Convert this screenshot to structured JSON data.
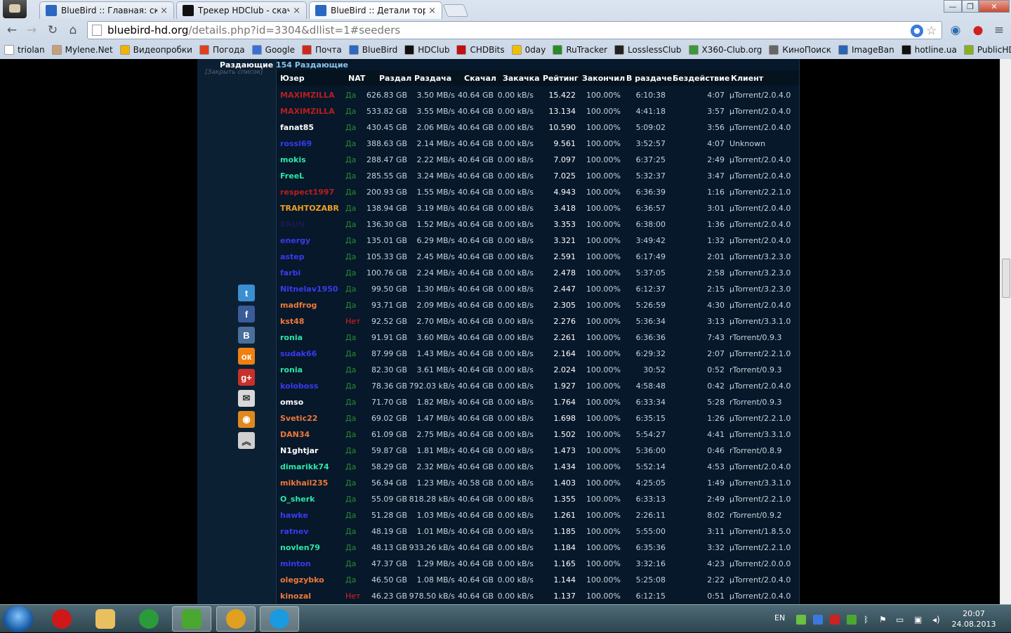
{
  "browser": {
    "tabs": [
      {
        "title": "BlueBird :: Главная: скача",
        "icon_color": "#2b68c2",
        "active": false
      },
      {
        "title": "Трекер HDClub - скачать",
        "icon_color": "#111111",
        "active": false
      },
      {
        "title": "BlueBird :: Детали торрен",
        "icon_color": "#2b68c2",
        "active": true
      }
    ],
    "url_host": "bluebird-hd.org",
    "url_rest": "/details.php?id=3304&dllist=1#seeders",
    "window_controls": [
      "minimize",
      "restore",
      "close"
    ],
    "bookmarks": [
      {
        "label": "triolan",
        "color": "#ffffff"
      },
      {
        "label": "Mylene.Net",
        "color": "#c8a078"
      },
      {
        "label": "Видеопробки",
        "color": "#f0b400"
      },
      {
        "label": "Погода",
        "color": "#e04020"
      },
      {
        "label": "Google",
        "color": "#3b6fd8"
      },
      {
        "label": "Почта",
        "color": "#d0281c"
      },
      {
        "label": "BlueBird",
        "color": "#2b68c2"
      },
      {
        "label": "HDClub",
        "color": "#111111"
      },
      {
        "label": "CHDBits",
        "color": "#c01010"
      },
      {
        "label": "0day",
        "color": "#f0c000"
      },
      {
        "label": "RuTracker",
        "color": "#2a8a2a"
      },
      {
        "label": "LosslessClub",
        "color": "#222222"
      },
      {
        "label": "X360-Club.org",
        "color": "#3a9a3a"
      },
      {
        "label": "КиноПоиск",
        "color": "#666666"
      },
      {
        "label": "ImageBan",
        "color": "#2a64b8"
      },
      {
        "label": "hotline.ua",
        "color": "#111111"
      },
      {
        "label": "PublicHD",
        "color": "#8ab020"
      }
    ]
  },
  "section": {
    "label": "Раздающие",
    "close_link": "[Закрыть список]",
    "count": "154 Раздающие"
  },
  "share_icons": [
    {
      "name": "twitter-icon",
      "glyph": "t",
      "color": "#3a8fd0"
    },
    {
      "name": "facebook-icon",
      "glyph": "f",
      "color": "#3b5b98"
    },
    {
      "name": "vkontakte-icon",
      "glyph": "B",
      "color": "#4a6f9a"
    },
    {
      "name": "odnoklassniki-icon",
      "glyph": "ок",
      "color": "#f08010"
    },
    {
      "name": "google-plus-icon",
      "glyph": "g+",
      "color": "#c8302a"
    },
    {
      "name": "mail-icon",
      "glyph": "✉",
      "color": "#d8d8d8"
    },
    {
      "name": "rss-icon",
      "glyph": "◉",
      "color": "#e08820"
    },
    {
      "name": "scroll-top-icon",
      "glyph": "︽",
      "color": "#d0d0d0"
    }
  ],
  "table": {
    "columns": [
      "Юзер",
      "NAT",
      "Раздал",
      "Раздача",
      "Скачал",
      "Закачка",
      "Рейтинг",
      "Закончил",
      "В раздаче",
      "Бездействие",
      "Клиент"
    ],
    "rows": [
      {
        "user": "MAXIMZILLA",
        "color": "#b81e1e",
        "nat": "Да",
        "uploaded": "626.83 GB",
        "up_speed": "3.50 MB/s",
        "downloaded": "40.64 GB",
        "down_speed": "0.00 kB/s",
        "ratio": "15.422",
        "done": "100.00%",
        "seeding": "6:10:38",
        "idle": "4:07",
        "client": "µTorrent/2.0.4.0"
      },
      {
        "user": "MAXIMZILLA",
        "color": "#b81e1e",
        "nat": "Да",
        "uploaded": "533.82 GB",
        "up_speed": "3.55 MB/s",
        "downloaded": "40.64 GB",
        "down_speed": "0.00 kB/s",
        "ratio": "13.134",
        "done": "100.00%",
        "seeding": "4:41:18",
        "idle": "3:57",
        "client": "µTorrent/2.0.4.0"
      },
      {
        "user": "fanat85",
        "color": "#ffffff",
        "nat": "Да",
        "uploaded": "430.45 GB",
        "up_speed": "2.06 MB/s",
        "downloaded": "40.64 GB",
        "down_speed": "0.00 kB/s",
        "ratio": "10.590",
        "done": "100.00%",
        "seeding": "5:09:02",
        "idle": "3:56",
        "client": "µTorrent/2.0.4.0"
      },
      {
        "user": "rossi69",
        "color": "#3a3af0",
        "nat": "Да",
        "uploaded": "388.63 GB",
        "up_speed": "2.14 MB/s",
        "downloaded": "40.64 GB",
        "down_speed": "0.00 kB/s",
        "ratio": "9.561",
        "done": "100.00%",
        "seeding": "3:52:57",
        "idle": "4:07",
        "client": "Unknown"
      },
      {
        "user": "mokis",
        "color": "#2ee6a8",
        "nat": "Да",
        "uploaded": "288.47 GB",
        "up_speed": "2.22 MB/s",
        "downloaded": "40.64 GB",
        "down_speed": "0.00 kB/s",
        "ratio": "7.097",
        "done": "100.00%",
        "seeding": "6:37:25",
        "idle": "2:49",
        "client": "µTorrent/2.0.4.0"
      },
      {
        "user": "FreeL",
        "color": "#2ee6a8",
        "nat": "Да",
        "uploaded": "285.55 GB",
        "up_speed": "3.24 MB/s",
        "downloaded": "40.64 GB",
        "down_speed": "0.00 kB/s",
        "ratio": "7.025",
        "done": "100.00%",
        "seeding": "5:32:37",
        "idle": "3:47",
        "client": "µTorrent/2.0.4.0"
      },
      {
        "user": "respect1997",
        "color": "#b81e1e",
        "nat": "Да",
        "uploaded": "200.93 GB",
        "up_speed": "1.55 MB/s",
        "downloaded": "40.64 GB",
        "down_speed": "0.00 kB/s",
        "ratio": "4.943",
        "done": "100.00%",
        "seeding": "6:36:39",
        "idle": "1:16",
        "client": "µTorrent/2.2.1.0"
      },
      {
        "user": "TRAHTOZABR",
        "color": "#f0a020",
        "nat": "Да",
        "uploaded": "138.94 GB",
        "up_speed": "3.19 MB/s",
        "downloaded": "40.64 GB",
        "down_speed": "0.00 kB/s",
        "ratio": "3.418",
        "done": "100.00%",
        "seeding": "6:36:57",
        "idle": "3:01",
        "client": "µTorrent/2.0.4.0"
      },
      {
        "user": "BRUN",
        "color": "#1a1a4a",
        "nat": "Да",
        "uploaded": "136.30 GB",
        "up_speed": "1.52 MB/s",
        "downloaded": "40.64 GB",
        "down_speed": "0.00 kB/s",
        "ratio": "3.353",
        "done": "100.00%",
        "seeding": "6:38:00",
        "idle": "1:36",
        "client": "µTorrent/2.0.4.0"
      },
      {
        "user": "energy",
        "color": "#3a3af0",
        "nat": "Да",
        "uploaded": "135.01 GB",
        "up_speed": "6.29 MB/s",
        "downloaded": "40.64 GB",
        "down_speed": "0.00 kB/s",
        "ratio": "3.321",
        "done": "100.00%",
        "seeding": "3:49:42",
        "idle": "1:32",
        "client": "µTorrent/2.0.4.0"
      },
      {
        "user": "astep",
        "color": "#3a3af0",
        "nat": "Да",
        "uploaded": "105.33 GB",
        "up_speed": "2.45 MB/s",
        "downloaded": "40.64 GB",
        "down_speed": "0.00 kB/s",
        "ratio": "2.591",
        "done": "100.00%",
        "seeding": "6:17:49",
        "idle": "2:01",
        "client": "µTorrent/3.2.3.0"
      },
      {
        "user": "farbi",
        "color": "#3a3af0",
        "nat": "Да",
        "uploaded": "100.76 GB",
        "up_speed": "2.24 MB/s",
        "downloaded": "40.64 GB",
        "down_speed": "0.00 kB/s",
        "ratio": "2.478",
        "done": "100.00%",
        "seeding": "5:37:05",
        "idle": "2:58",
        "client": "µTorrent/3.2.3.0"
      },
      {
        "user": "Nitnelav1950",
        "color": "#3a3af0",
        "nat": "Да",
        "uploaded": "99.50 GB",
        "up_speed": "1.30 MB/s",
        "downloaded": "40.64 GB",
        "down_speed": "0.00 kB/s",
        "ratio": "2.447",
        "done": "100.00%",
        "seeding": "6:12:37",
        "idle": "2:15",
        "client": "µTorrent/3.2.3.0"
      },
      {
        "user": "madfrog",
        "color": "#f07838",
        "nat": "Да",
        "uploaded": "93.71 GB",
        "up_speed": "2.09 MB/s",
        "downloaded": "40.64 GB",
        "down_speed": "0.00 kB/s",
        "ratio": "2.305",
        "done": "100.00%",
        "seeding": "5:26:59",
        "idle": "4:30",
        "client": "µTorrent/2.0.4.0"
      },
      {
        "user": "kst48",
        "color": "#f07838",
        "nat": "Нет",
        "uploaded": "92.52 GB",
        "up_speed": "2.70 MB/s",
        "downloaded": "40.64 GB",
        "down_speed": "0.00 kB/s",
        "ratio": "2.276",
        "done": "100.00%",
        "seeding": "5:36:34",
        "idle": "3:13",
        "client": "µTorrent/3.3.1.0"
      },
      {
        "user": "ronia",
        "color": "#2ee6a8",
        "nat": "Да",
        "uploaded": "91.91 GB",
        "up_speed": "3.60 MB/s",
        "downloaded": "40.64 GB",
        "down_speed": "0.00 kB/s",
        "ratio": "2.261",
        "done": "100.00%",
        "seeding": "6:36:36",
        "idle": "7:43",
        "client": "rTorrent/0.9.3"
      },
      {
        "user": "sudak66",
        "color": "#3a3af0",
        "nat": "Да",
        "uploaded": "87.99 GB",
        "up_speed": "1.43 MB/s",
        "downloaded": "40.64 GB",
        "down_speed": "0.00 kB/s",
        "ratio": "2.164",
        "done": "100.00%",
        "seeding": "6:29:32",
        "idle": "2:07",
        "client": "µTorrent/2.2.1.0"
      },
      {
        "user": "ronia",
        "color": "#2ee6a8",
        "nat": "Да",
        "uploaded": "82.30 GB",
        "up_speed": "3.61 MB/s",
        "downloaded": "40.64 GB",
        "down_speed": "0.00 kB/s",
        "ratio": "2.024",
        "done": "100.00%",
        "seeding": "30:52",
        "idle": "0:52",
        "client": "rTorrent/0.9.3"
      },
      {
        "user": "koloboss",
        "color": "#3a3af0",
        "nat": "Да",
        "uploaded": "78.36 GB",
        "up_speed": "792.03 kB/s",
        "downloaded": "40.64 GB",
        "down_speed": "0.00 kB/s",
        "ratio": "1.927",
        "done": "100.00%",
        "seeding": "4:58:48",
        "idle": "0:42",
        "client": "µTorrent/2.0.4.0"
      },
      {
        "user": "omso",
        "color": "#ffffff",
        "nat": "Да",
        "uploaded": "71.70 GB",
        "up_speed": "1.82 MB/s",
        "downloaded": "40.64 GB",
        "down_speed": "0.00 kB/s",
        "ratio": "1.764",
        "done": "100.00%",
        "seeding": "6:33:34",
        "idle": "5:28",
        "client": "rTorrent/0.9.3"
      },
      {
        "user": "Svetic22",
        "color": "#f07838",
        "nat": "Да",
        "uploaded": "69.02 GB",
        "up_speed": "1.47 MB/s",
        "downloaded": "40.64 GB",
        "down_speed": "0.00 kB/s",
        "ratio": "1.698",
        "done": "100.00%",
        "seeding": "6:35:15",
        "idle": "1:26",
        "client": "µTorrent/2.2.1.0"
      },
      {
        "user": "DAN34",
        "color": "#f07838",
        "nat": "Да",
        "uploaded": "61.09 GB",
        "up_speed": "2.75 MB/s",
        "downloaded": "40.64 GB",
        "down_speed": "0.00 kB/s",
        "ratio": "1.502",
        "done": "100.00%",
        "seeding": "5:54:27",
        "idle": "4:41",
        "client": "µTorrent/3.3.1.0"
      },
      {
        "user": "N1ghtjar",
        "color": "#ffffff",
        "nat": "Да",
        "uploaded": "59.87 GB",
        "up_speed": "1.81 MB/s",
        "downloaded": "40.64 GB",
        "down_speed": "0.00 kB/s",
        "ratio": "1.473",
        "done": "100.00%",
        "seeding": "5:36:00",
        "idle": "0:46",
        "client": "rTorrent/0.8.9"
      },
      {
        "user": "dimarikk74",
        "color": "#2ee6a8",
        "nat": "Да",
        "uploaded": "58.29 GB",
        "up_speed": "2.32 MB/s",
        "downloaded": "40.64 GB",
        "down_speed": "0.00 kB/s",
        "ratio": "1.434",
        "done": "100.00%",
        "seeding": "5:52:14",
        "idle": "4:53",
        "client": "µTorrent/2.0.4.0"
      },
      {
        "user": "mikhail235",
        "color": "#f07838",
        "nat": "Да",
        "uploaded": "56.94 GB",
        "up_speed": "1.23 MB/s",
        "downloaded": "40.58 GB",
        "down_speed": "0.00 kB/s",
        "ratio": "1.403",
        "done": "100.00%",
        "seeding": "4:25:05",
        "idle": "1:49",
        "client": "µTorrent/3.3.1.0"
      },
      {
        "user": "O_sherk",
        "color": "#2ee6a8",
        "nat": "Да",
        "uploaded": "55.09 GB",
        "up_speed": "818.28 kB/s",
        "downloaded": "40.64 GB",
        "down_speed": "0.00 kB/s",
        "ratio": "1.355",
        "done": "100.00%",
        "seeding": "6:33:13",
        "idle": "2:49",
        "client": "µTorrent/2.2.1.0"
      },
      {
        "user": "hawke",
        "color": "#3a3af0",
        "nat": "Да",
        "uploaded": "51.28 GB",
        "up_speed": "1.03 MB/s",
        "downloaded": "40.64 GB",
        "down_speed": "0.00 kB/s",
        "ratio": "1.261",
        "done": "100.00%",
        "seeding": "2:26:11",
        "idle": "8:02",
        "client": "rTorrent/0.9.2"
      },
      {
        "user": "ratnev",
        "color": "#3a3af0",
        "nat": "Да",
        "uploaded": "48.19 GB",
        "up_speed": "1.01 MB/s",
        "downloaded": "40.64 GB",
        "down_speed": "0.00 kB/s",
        "ratio": "1.185",
        "done": "100.00%",
        "seeding": "5:55:00",
        "idle": "3:11",
        "client": "µTorrent/1.8.5.0"
      },
      {
        "user": "novlen79",
        "color": "#2ee6a8",
        "nat": "Да",
        "uploaded": "48.13 GB",
        "up_speed": "933.26 kB/s",
        "downloaded": "40.64 GB",
        "down_speed": "0.00 kB/s",
        "ratio": "1.184",
        "done": "100.00%",
        "seeding": "6:35:36",
        "idle": "3:32",
        "client": "µTorrent/2.2.1.0"
      },
      {
        "user": "minton",
        "color": "#3a3af0",
        "nat": "Да",
        "uploaded": "47.37 GB",
        "up_speed": "1.29 MB/s",
        "downloaded": "40.64 GB",
        "down_speed": "0.00 kB/s",
        "ratio": "1.165",
        "done": "100.00%",
        "seeding": "3:32:16",
        "idle": "4:23",
        "client": "µTorrent/2.0.0.0"
      },
      {
        "user": "olegzybko",
        "color": "#f07838",
        "nat": "Да",
        "uploaded": "46.50 GB",
        "up_speed": "1.08 MB/s",
        "downloaded": "40.64 GB",
        "down_speed": "0.00 kB/s",
        "ratio": "1.144",
        "done": "100.00%",
        "seeding": "5:25:08",
        "idle": "2:22",
        "client": "µTorrent/2.0.4.0"
      },
      {
        "user": "kinozal",
        "color": "#f07838",
        "nat": "Нет",
        "uploaded": "46.23 GB",
        "up_speed": "978.50 kB/s",
        "downloaded": "40.64 GB",
        "down_speed": "0.00 kB/s",
        "ratio": "1.137",
        "done": "100.00%",
        "seeding": "6:12:15",
        "idle": "0:51",
        "client": "µTorrent/2.0.4.0"
      }
    ]
  },
  "colors": {
    "nat_yes": "#2a8a2a",
    "nat_no": "#e02020"
  },
  "taskbar": {
    "apps": [
      {
        "name": "opera",
        "color": "#d01818",
        "active": false
      },
      {
        "name": "file-explorer",
        "color": "#e8c060",
        "active": false
      },
      {
        "name": "chrome",
        "color": "#2a9a3a",
        "active": false
      },
      {
        "name": "utorrent",
        "color": "#4aa830",
        "active": true
      },
      {
        "name": "chrome-window",
        "color": "#e0a020",
        "active": true
      },
      {
        "name": "skype",
        "color": "#1a9ae0",
        "active": true
      }
    ],
    "language": "EN",
    "time": "20:07",
    "date": "24.08.2013"
  }
}
